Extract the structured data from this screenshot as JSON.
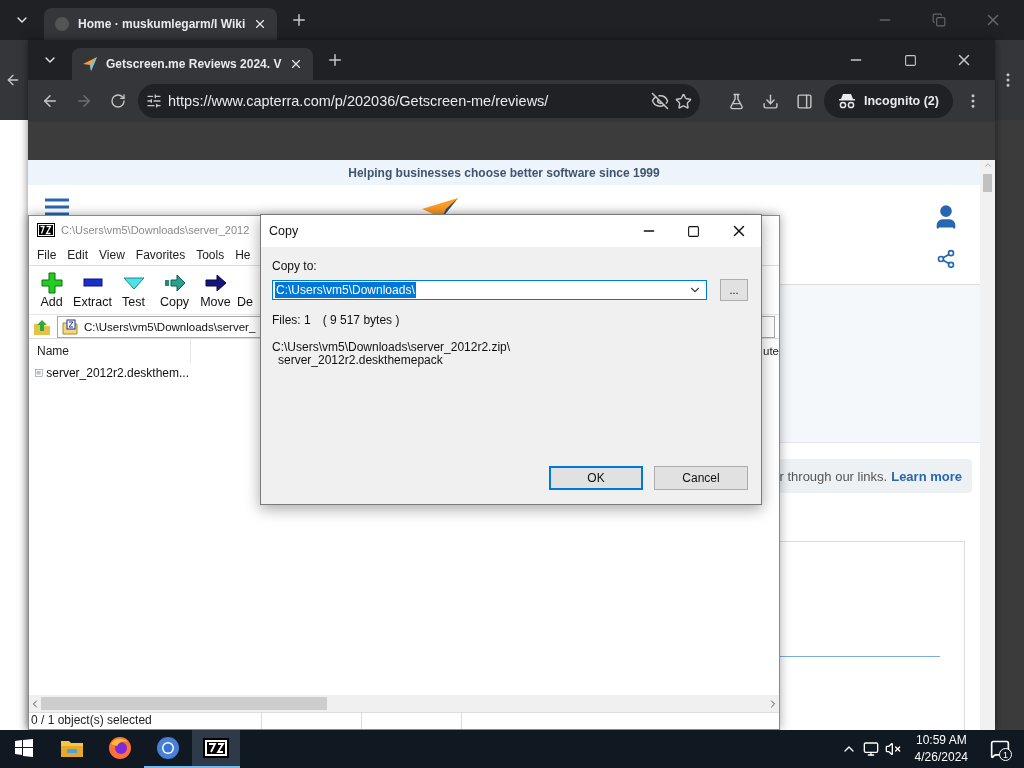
{
  "back_browser": {
    "tab": {
      "title": "Home · muskumlegarm/l Wiki"
    }
  },
  "browser": {
    "tab": {
      "title": "Getscreen.me Reviews 2024. V"
    },
    "url": "https://www.capterra.com/p/202036/Getscreen-me/reviews/",
    "profile": "Incognito (2)"
  },
  "page": {
    "banner": "Helping businesses choose better software since 1999",
    "notice_text": "r through our links.",
    "notice_link": "Learn more"
  },
  "archiver": {
    "title": "C:\\Users\\vm5\\Downloads\\server_2012",
    "menu": [
      "File",
      "Edit",
      "View",
      "Favorites",
      "Tools",
      "He"
    ],
    "tools": [
      {
        "label": "Add",
        "kind": "add"
      },
      {
        "label": "Extract",
        "kind": "extract"
      },
      {
        "label": "Test",
        "kind": "test"
      },
      {
        "label": "Copy",
        "kind": "copy"
      },
      {
        "label": "Move",
        "kind": "move"
      },
      {
        "label": "De",
        "kind": "delete"
      }
    ],
    "path": "C:\\Users\\vm5\\Downloads\\server_",
    "columns": [
      "Name",
      "ute"
    ],
    "files": [
      {
        "name": "server_2012r2.deskthem...",
        "selected": false
      }
    ],
    "status": "0 / 1 object(s) selected"
  },
  "dialog": {
    "title": "Copy",
    "label": "Copy to:",
    "destination": "C:\\Users\\vm5\\Downloads\\",
    "browse": "...",
    "files": "Files: 1",
    "size": "( 9 517 bytes )",
    "source": [
      "C:\\Users\\vm5\\Downloads\\server_2012r2.zip\\",
      "server_2012r2.deskthemepack"
    ],
    "buttons": [
      {
        "label": "OK",
        "default": true
      },
      {
        "label": "Cancel",
        "default": false
      }
    ]
  },
  "taskbar": {
    "apps": [
      {
        "kind": "explorer",
        "running": false,
        "active": false
      },
      {
        "kind": "firefox",
        "running": false,
        "active": false
      },
      {
        "kind": "chrome",
        "running": true,
        "active": false
      },
      {
        "kind": "archiver",
        "running": true,
        "active": true
      }
    ],
    "time": "10:59 AM",
    "date": "4/26/2024",
    "notifications": "1"
  }
}
